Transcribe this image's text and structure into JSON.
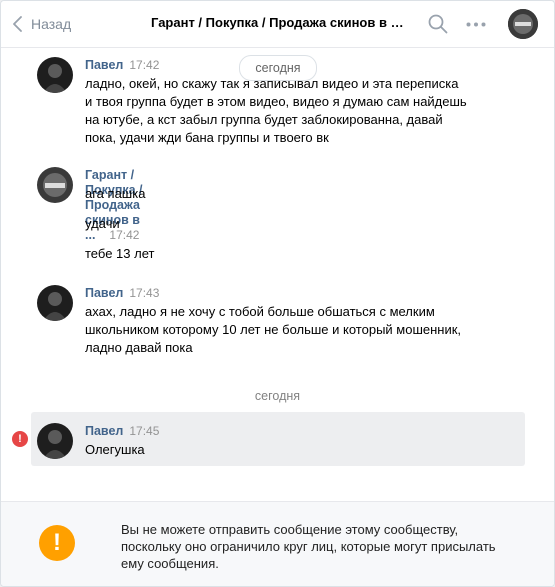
{
  "header": {
    "back_label": "Назад",
    "title": "Гарант / Покупка / Продажа скинов в КС ГО"
  },
  "date_pill": "сегодня",
  "messages": [
    {
      "author": "Павел",
      "time": "17:42",
      "lines": [
        "ладно, окей, но скажу так я записывал видео и эта переписка",
        "и твоя группа будет в этом видео, видео я думаю сам найдешь",
        "на ютубе, а кст забыл группа будет заблокированна, давай",
        "пока, удачи жди бана группы и твоего вк"
      ]
    },
    {
      "author": "Гарант / Покупка / Продажа скинов в ...",
      "time": "17:42",
      "lines": [
        "ага пашка",
        "удачи",
        "тебе 13 лет"
      ]
    },
    {
      "author": "Павел",
      "time": "17:43",
      "lines": [
        "ахах, ладно я не хочу с тобой больше обшаться с мелким",
        "школьником которому 10 лет не больше и который мошенник,",
        "ладно давай пока"
      ]
    },
    {
      "author": "Павел",
      "time": "17:45",
      "lines": [
        "Олегушка"
      ]
    }
  ],
  "divider": "сегодня",
  "footer": {
    "notice": "Вы не можете отправить сообщение этому сообществу, поскольку оно ограничило круг лиц, которые могут присылать ему сообщения."
  },
  "icons": {
    "back": "chevron-left-icon",
    "search": "search-icon",
    "more": "more-dots-icon",
    "error": "error-icon",
    "warning": "warning-icon"
  },
  "colors": {
    "link": "#42648b",
    "error": "#e64646",
    "warning": "#ffa000",
    "highlight": "#edeef0"
  }
}
